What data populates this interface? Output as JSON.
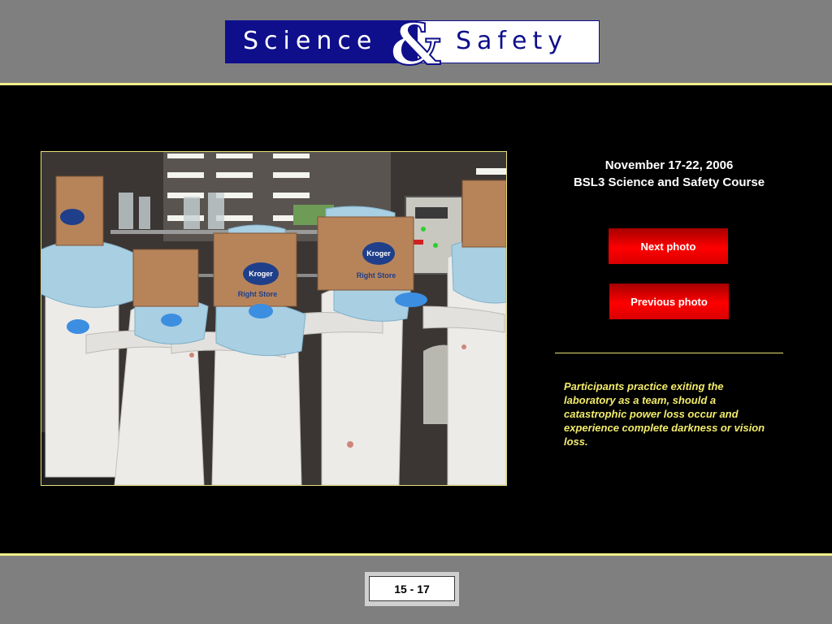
{
  "header": {
    "logo_word_left": "Science",
    "logo_amp": "&",
    "logo_word_right": "Safety",
    "logo_colors": {
      "navy": "#0f0f8c",
      "white": "#ffffff"
    }
  },
  "main": {
    "photo": {
      "bag_label": "Kroger",
      "bag_sublabel": "Right Store"
    },
    "event_date": "November 17-22, 2006",
    "event_title": "BSL3 Science and Safety Course",
    "next_button": "Next photo",
    "prev_button": "Previous photo",
    "caption": "Participants practice exiting the laboratory as a team, should a catastrophic power loss occur and experience complete darkness or vision loss.",
    "accent_colors": {
      "rule": "#f0f088",
      "button": "#ff0000",
      "caption": "#f3ec6b"
    }
  },
  "footer": {
    "page_indicator": "15 - 17"
  }
}
